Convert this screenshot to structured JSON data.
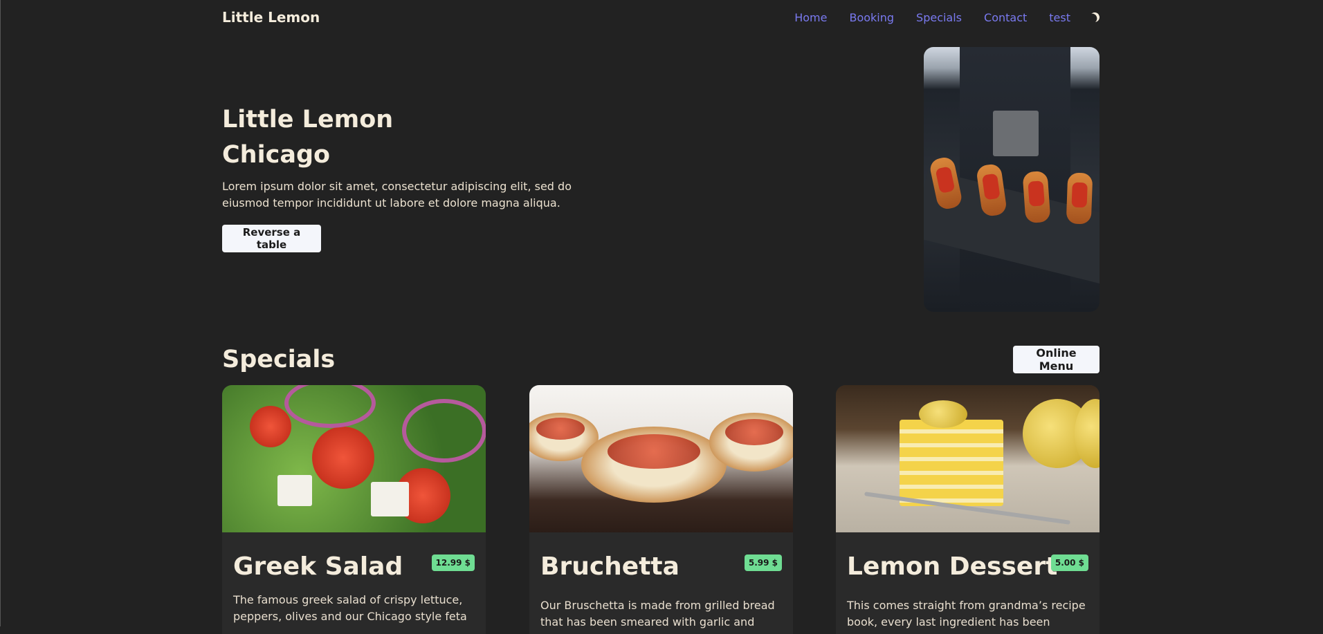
{
  "nav": {
    "brand": "Little Lemon",
    "links": [
      "Home",
      "Booking",
      "Specials",
      "Contact",
      "test"
    ],
    "theme_icon": "moon-icon"
  },
  "hero": {
    "title_line1": "Little Lemon",
    "title_line2": "Chicago",
    "description": "Lorem ipsum dolor sit amet, consectetur adipiscing elit, sed do eiusmod tempor incididunt ut labore et dolore magna aliqua.",
    "cta": "Reverse a table"
  },
  "specials": {
    "title": "Specials",
    "online_menu": "Online Menu",
    "items": [
      {
        "name": "Greek Salad",
        "price": "12.99 $",
        "desc": "The famous greek salad of crispy lettuce, peppers, olives and our Chicago style feta"
      },
      {
        "name": "Bruchetta",
        "price": "5.99 $",
        "desc": "Our Bruschetta is made from grilled bread that has been smeared with garlic and seasoned with"
      },
      {
        "name": "Lemon Dessert",
        "price": "5.00 $",
        "desc": "This comes straight from grandma’s recipe book, every last ingredient has been sourced and is as"
      }
    ]
  },
  "colors": {
    "background": "#222222",
    "nav_link": "#7a7af0",
    "price_badge": "#6fdd93"
  }
}
